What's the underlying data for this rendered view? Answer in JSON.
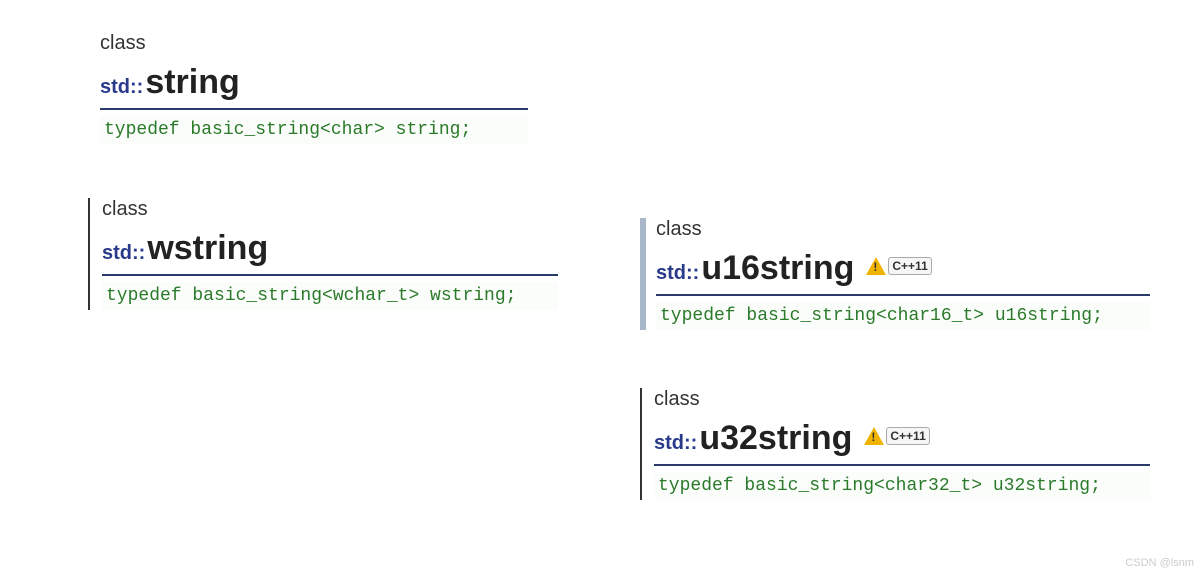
{
  "blocks": {
    "b1": {
      "class_label": "class",
      "prefix": "std::",
      "name": "string",
      "typedef": "typedef basic_string<char> string;",
      "has_cpp11": false
    },
    "b2": {
      "class_label": "class",
      "prefix": "std::",
      "name": "wstring",
      "typedef": "typedef basic_string<wchar_t> wstring;",
      "has_cpp11": false
    },
    "b3": {
      "class_label": "class",
      "prefix": "std::",
      "name": "u16string",
      "typedef": "typedef basic_string<char16_t> u16string;",
      "has_cpp11": true,
      "badge_text": "C++11"
    },
    "b4": {
      "class_label": "class",
      "prefix": "std::",
      "name": "u32string",
      "typedef": "typedef basic_string<char32_t> u32string;",
      "has_cpp11": true,
      "badge_text": "C++11"
    }
  },
  "watermark": "CSDN @lsnm"
}
